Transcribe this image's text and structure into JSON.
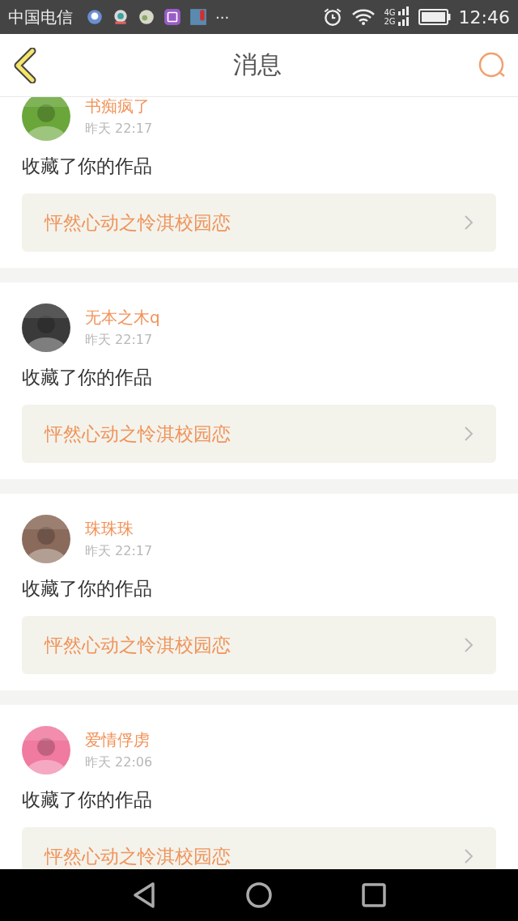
{
  "status_bar": {
    "carrier": "中国电信",
    "more": "···",
    "network_top": "4G",
    "network_bottom": "2G",
    "time": "12:46"
  },
  "header": {
    "title": "消息"
  },
  "messages": [
    {
      "name": "书痴疯了",
      "time": "昨天 22:17",
      "action": "收藏了你的作品",
      "work_title": "怦然心动之怜淇校园恋"
    },
    {
      "name": "无本之木q",
      "time": "昨天 22:17",
      "action": "收藏了你的作品",
      "work_title": "怦然心动之怜淇校园恋"
    },
    {
      "name": "珠珠珠",
      "time": "昨天 22:17",
      "action": "收藏了你的作品",
      "work_title": "怦然心动之怜淇校园恋"
    },
    {
      "name": "爱情俘虏",
      "time": "昨天 22:06",
      "action": "收藏了你的作品",
      "work_title": "怦然心动之怜淇校园恋"
    }
  ]
}
